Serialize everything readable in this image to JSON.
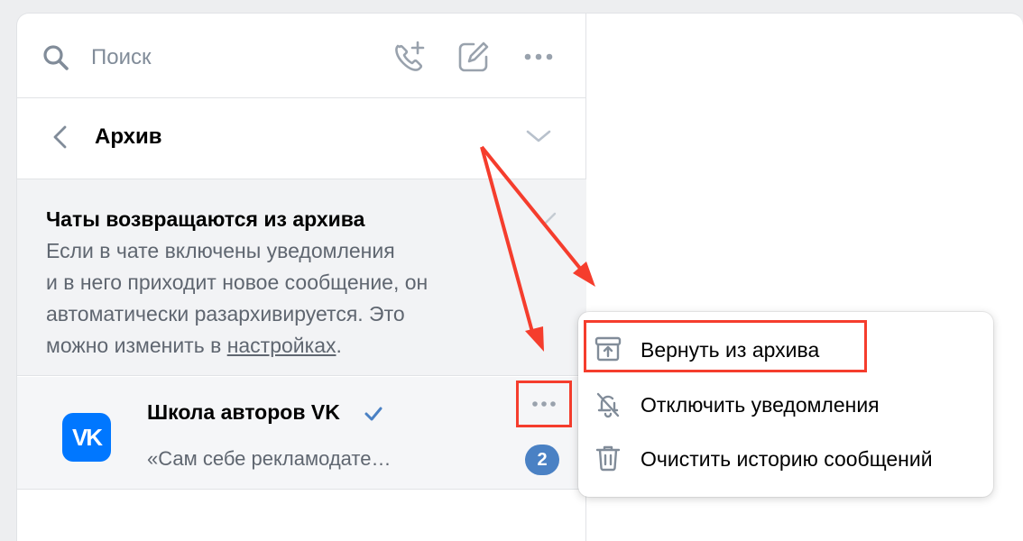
{
  "search": {
    "placeholder": "Поиск"
  },
  "toolbar": {
    "call_icon": "phone-plus-icon",
    "compose_icon": "compose-icon",
    "more_icon": "more-horizontal-icon"
  },
  "archive": {
    "title": "Архив"
  },
  "info": {
    "title": "Чаты возвращаются из архива",
    "text_lines": [
      "Если в чате включены уведомления",
      "и в него приходит новое сообщение, он",
      "автоматически разархивируется. Это"
    ],
    "line4_prefix": "можно изменить в ",
    "link_text": "настройках",
    "line4_suffix": "."
  },
  "chat": {
    "avatar_text": "VK",
    "name": "Школа авторов VK",
    "preview": "«Сам себе рекламодате…",
    "unread_count": "2"
  },
  "context_menu": {
    "items": [
      {
        "label": "Вернуть из архива",
        "icon": "unarchive-icon"
      },
      {
        "label": "Отключить уведомления",
        "icon": "bell-off-icon"
      },
      {
        "label": "Очистить историю сообщений",
        "icon": "trash-icon"
      }
    ]
  },
  "colors": {
    "accent": "#0077ff",
    "annotation_red": "#f53d2d",
    "badge": "#4a81c4",
    "secondary_text": "#5f6670"
  }
}
